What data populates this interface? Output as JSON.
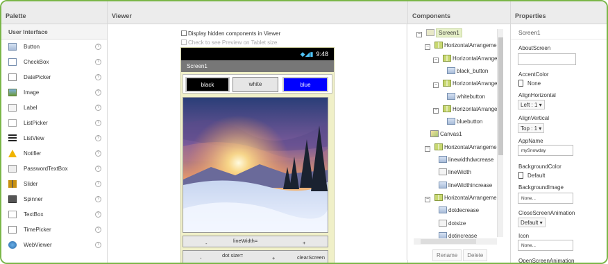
{
  "palette": {
    "header": "Palette",
    "category": "User Interface",
    "items": [
      {
        "label": "Button",
        "icon": "button-icon"
      },
      {
        "label": "CheckBox",
        "icon": "checkbox-icon"
      },
      {
        "label": "DatePicker",
        "icon": "datepicker-icon"
      },
      {
        "label": "Image",
        "icon": "image-icon"
      },
      {
        "label": "Label",
        "icon": "label-icon"
      },
      {
        "label": "ListPicker",
        "icon": "listpicker-icon"
      },
      {
        "label": "ListView",
        "icon": "listview-icon"
      },
      {
        "label": "Notifier",
        "icon": "notifier-icon"
      },
      {
        "label": "PasswordTextBox",
        "icon": "password-icon"
      },
      {
        "label": "Slider",
        "icon": "slider-icon"
      },
      {
        "label": "Spinner",
        "icon": "spinner-icon"
      },
      {
        "label": "TextBox",
        "icon": "textbox-icon"
      },
      {
        "label": "TimePicker",
        "icon": "timepicker-icon"
      },
      {
        "label": "WebViewer",
        "icon": "webviewer-icon"
      }
    ],
    "help_glyph": "?"
  },
  "viewer": {
    "header": "Viewer",
    "display_hidden": "Display hidden components in Viewer",
    "tablet_preview": "Check to see Preview on Tablet size.",
    "status_time": "9:48",
    "status_icons": "◆◢▮",
    "screen_title": "Screen1",
    "buttons": [
      {
        "label": "black",
        "bg": "#000000",
        "fg": "#ffffff"
      },
      {
        "label": "white",
        "bg": "#e6e6e6",
        "fg": "#333333"
      },
      {
        "label": "blue",
        "bg": "#0000ff",
        "fg": "#ffffff"
      }
    ],
    "line_row": {
      "minus": "-",
      "label": "lineWidth=",
      "plus": "+"
    },
    "dot_row": {
      "minus": "-",
      "label": "dot size=",
      "plus": "+",
      "clear": "clearScreen"
    }
  },
  "components": {
    "header": "Components",
    "tree": [
      {
        "label": "Screen1",
        "indent": 0,
        "toggle": "⊟",
        "icon": "screen-icon",
        "selected": true
      },
      {
        "label": "HorizontalArrangemen",
        "indent": 1,
        "toggle": "⊟",
        "icon": "arrangement-icon"
      },
      {
        "label": "HorizontalArrangem",
        "indent": 2,
        "toggle": "⊟",
        "icon": "arrangement-icon"
      },
      {
        "label": "black_button",
        "indent": 3,
        "toggle": "",
        "icon": "button-icon"
      },
      {
        "label": "HorizontalArrangem",
        "indent": 2,
        "toggle": "⊟",
        "icon": "arrangement-icon"
      },
      {
        "label": "whitebutton",
        "indent": 3,
        "toggle": "",
        "icon": "button-icon"
      },
      {
        "label": "HorizontalArrangem",
        "indent": 2,
        "toggle": "⊟",
        "icon": "arrangement-icon"
      },
      {
        "label": "bluebutton",
        "indent": 3,
        "toggle": "",
        "icon": "button-icon"
      },
      {
        "label": "Canvas1",
        "indent": 1,
        "toggle": "",
        "icon": "canvas-icon"
      },
      {
        "label": "HorizontalArrangemen",
        "indent": 1,
        "toggle": "⊟",
        "icon": "arrangement-icon"
      },
      {
        "label": "linewidthdwcrease",
        "indent": 2,
        "toggle": "",
        "icon": "button-icon"
      },
      {
        "label": "lineWidth",
        "indent": 2,
        "toggle": "",
        "icon": "label-icon"
      },
      {
        "label": "lineWidthincrease",
        "indent": 2,
        "toggle": "",
        "icon": "button-icon"
      },
      {
        "label": "HorizontalArrangemen",
        "indent": 1,
        "toggle": "⊟",
        "icon": "arrangement-icon"
      },
      {
        "label": "dotdecrease",
        "indent": 2,
        "toggle": "",
        "icon": "button-icon"
      },
      {
        "label": "dotsize",
        "indent": 2,
        "toggle": "",
        "icon": "label-icon"
      },
      {
        "label": "dotincrease",
        "indent": 2,
        "toggle": "",
        "icon": "button-icon"
      }
    ],
    "rename": "Rename",
    "delete": "Delete"
  },
  "properties": {
    "header": "Properties",
    "selected": "Screen1",
    "about_label": "AboutScreen",
    "about_value": "",
    "accent_label": "AccentColor",
    "accent_value": "None",
    "align_h_label": "AlignHorizontal",
    "align_h_value": "Left : 1 ▾",
    "align_v_label": "AlignVertical",
    "align_v_value": "Top : 1 ▾",
    "appname_label": "AppName",
    "appname_value": "mySnowday",
    "bgcolor_label": "BackgroundColor",
    "bgcolor_value": "Default",
    "bgimage_label": "BackgroundImage",
    "bgimage_value": "None...",
    "close_anim_label": "CloseScreenAnimation",
    "close_anim_value": "Default ▾",
    "icon_label": "Icon",
    "icon_value": "None...",
    "open_anim_label": "OpenScreenAnimation"
  },
  "colors": {
    "accent": "#7ab648",
    "selected_bg": "#e6f0c8"
  }
}
